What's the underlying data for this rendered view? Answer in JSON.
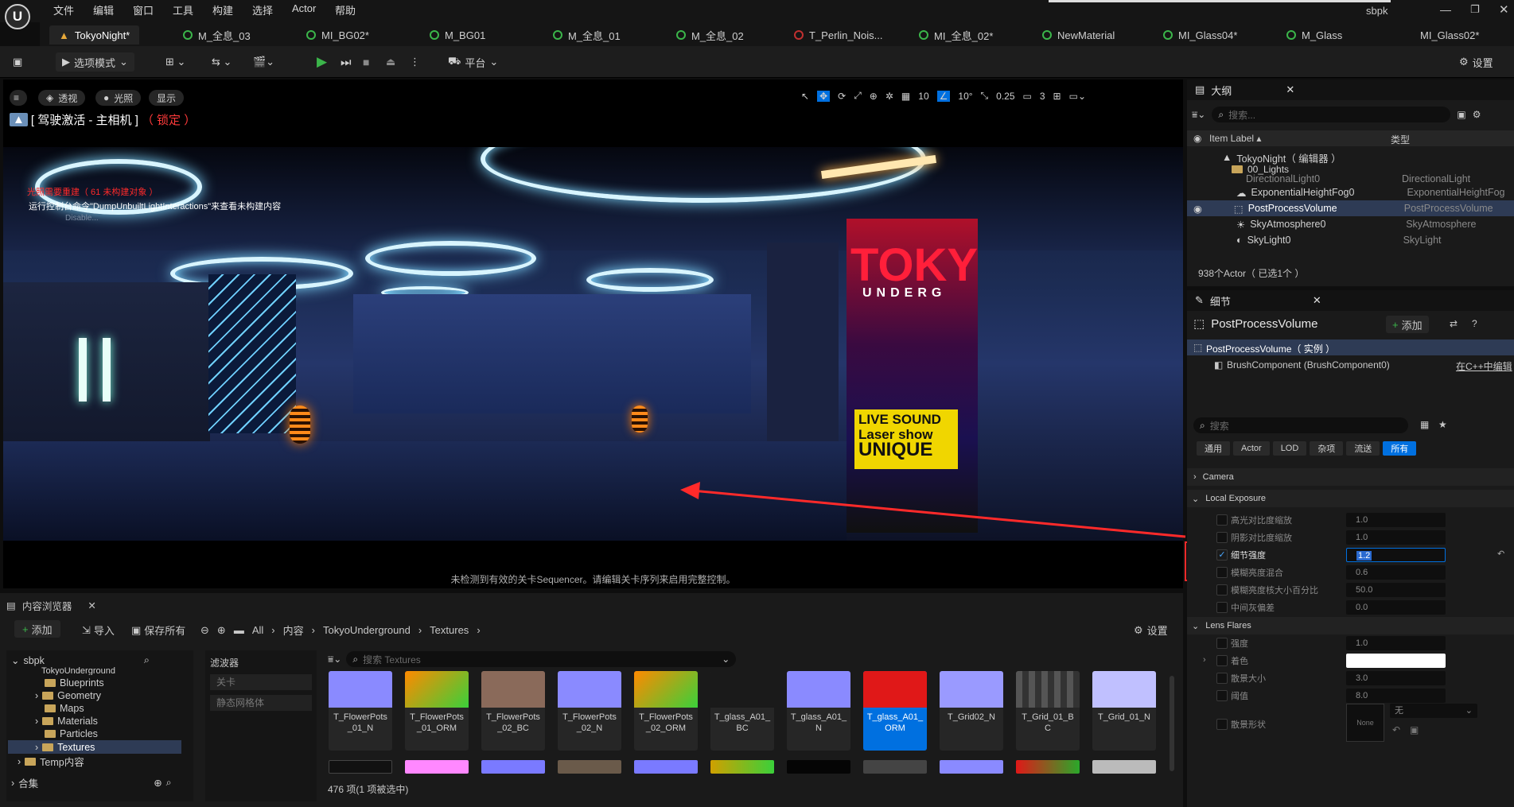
{
  "app": {
    "user": "sbpk"
  },
  "menu": [
    "文件",
    "编辑",
    "窗口",
    "工具",
    "构建",
    "选择",
    "Actor",
    "帮助"
  ],
  "tabs": [
    "TokyoNight*",
    "M_全息_03",
    "MI_BG02*",
    "M_BG01",
    "M_全息_01",
    "M_全息_02",
    "T_Perlin_Nois...",
    "MI_全息_02*",
    "NewMaterial",
    "MI_Glass04*",
    "M_Glass",
    "MI_Glass02*"
  ],
  "toolbar": {
    "mode": "选项模式",
    "platform": "平台",
    "settings": "设置"
  },
  "viewport": {
    "perspective": "透视",
    "lit": "光照",
    "show": "显示",
    "pilot_prefix": "[ 驾驶激活 - 主相机 ]",
    "pilot_locked": "（ 锁定 ）",
    "warning1": "光照需要重建（ 61 未构建对象 ）",
    "warning2": "运行控制台命令\"DumpUnbuiltLightInteractions\"来查看未构建内容",
    "warning3": "Disable...",
    "grid": "10",
    "angle": "10°",
    "scale": "0.25",
    "cam": "3",
    "sequencer_msg": "未检测到有效的关卡Sequencer。请编辑关卡序列来启用完整控制。"
  },
  "outliner": {
    "title": "大纲",
    "search_placeholder": "搜索...",
    "col_label": "Item Label ▴",
    "col_type": "类型",
    "root": "TokyoNight（ 编辑器 ）",
    "folder": "00_Lights",
    "items": [
      {
        "label": "DirectionalLight0",
        "type": "DirectionalLight"
      },
      {
        "label": "ExponentialHeightFog0",
        "type": "ExponentialHeightFog"
      },
      {
        "label": "PostProcessVolume",
        "type": "PostProcessVolume"
      },
      {
        "label": "SkyAtmosphere0",
        "type": "SkyAtmosphere"
      },
      {
        "label": "SkyLight0",
        "type": "SkyLight"
      }
    ],
    "count": "938个Actor（ 已选1个 ）"
  },
  "details": {
    "title": "细节",
    "object": "PostProcessVolume",
    "add": "添加",
    "instance": "PostProcessVolume（ 实例 ）",
    "component": "BrushComponent (BrushComponent0)",
    "cpp_link": "在C++中编辑",
    "search_placeholder": "搜索",
    "filters": [
      "通用",
      "Actor",
      "LOD",
      "杂项",
      "流送",
      "所有"
    ],
    "sections": {
      "camera": "Camera",
      "local_exposure": "Local Exposure",
      "lens_flares": "Lens Flares"
    },
    "le_rows": [
      {
        "label": "高光对比度缩放",
        "value": "1.0"
      },
      {
        "label": "阴影对比度缩放",
        "value": "1.0"
      },
      {
        "label": "细节强度",
        "value": "1.2"
      },
      {
        "label": "模糊亮度混合",
        "value": "0.6"
      },
      {
        "label": "模糊亮度核大小百分比",
        "value": "50.0"
      },
      {
        "label": "中间灰偏差",
        "value": "0.0"
      }
    ],
    "lf_rows": [
      {
        "label": "强度",
        "value": "1.0"
      },
      {
        "label": "着色",
        "value": ""
      },
      {
        "label": "散景大小",
        "value": "3.0"
      },
      {
        "label": "阈值",
        "value": "8.0"
      },
      {
        "label": "散景形状",
        "value": "无"
      }
    ],
    "none_tex": "None"
  },
  "content": {
    "title": "内容浏览器",
    "add": "添加",
    "import": "导入",
    "save_all": "保存所有",
    "settings": "设置",
    "crumbs": [
      "All",
      "内容",
      "TokyoUnderground",
      "Textures"
    ],
    "tree_root": "sbpk",
    "tree": [
      "TokyoUnderground",
      "Blueprints",
      "Geometry",
      "Maps",
      "Materials",
      "Particles",
      "Textures",
      "Temp内容"
    ],
    "collections": "合集",
    "filters_title": "滤波器",
    "filters": [
      "关卡",
      "静态网格体"
    ],
    "search_placeholder": "搜索 Textures",
    "assets": [
      "T_FlowerPots_01_N",
      "T_FlowerPots_01_ORM",
      "T_FlowerPots_02_BC",
      "T_FlowerPots_02_N",
      "T_FlowerPots_02_ORM",
      "T_glass_A01_BC",
      "T_glass_A01_N",
      "T_glass_A01_ORM",
      "T_Grid02_N",
      "T_Grid_01_BC",
      "T_Grid_01_N"
    ],
    "status": "476 项(1 项被选中)"
  },
  "colors": {
    "accent": "#0070e0",
    "warning": "#e01818",
    "highlight": "#ff2a2a"
  }
}
